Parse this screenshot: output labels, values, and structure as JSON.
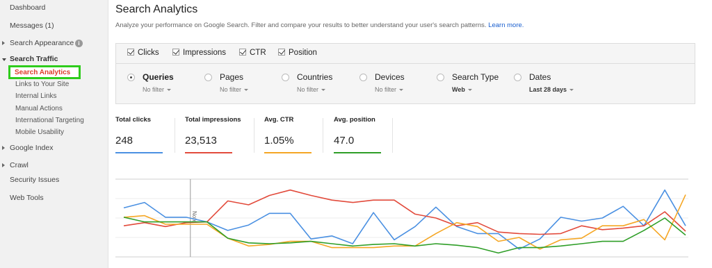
{
  "sidebar": {
    "dashboard": "Dashboard",
    "messages": "Messages (1)",
    "search_appearance": "Search Appearance",
    "info_icon": "i",
    "search_traffic": "Search Traffic",
    "search_analytics": "Search Analytics",
    "links_to_site": "Links to Your Site",
    "internal_links": "Internal Links",
    "manual_actions": "Manual Actions",
    "international_targeting": "International Targeting",
    "mobile_usability": "Mobile Usability",
    "google_index": "Google Index",
    "crawl": "Crawl",
    "security_issues": "Security Issues",
    "web_tools": "Web Tools"
  },
  "header": {
    "title": "Search Analytics",
    "description": "Analyze your performance on Google Search. Filter and compare your results to better understand your user's search patterns.",
    "learn_more": "Learn more."
  },
  "toggles": {
    "clicks": "Clicks",
    "impressions": "Impressions",
    "ctr": "CTR",
    "position": "Position"
  },
  "dimensions": {
    "queries": {
      "label": "Queries",
      "value": "No filter"
    },
    "pages": {
      "label": "Pages",
      "value": "No filter"
    },
    "countries": {
      "label": "Countries",
      "value": "No filter"
    },
    "devices": {
      "label": "Devices",
      "value": "No filter"
    },
    "search_type": {
      "label": "Search Type",
      "value": "Web"
    },
    "dates": {
      "label": "Dates",
      "value": "Last 28 days"
    }
  },
  "selected_dimension": "Queries",
  "metrics": {
    "clicks": {
      "label": "Total clicks",
      "value": "248",
      "color": "#4a90e2"
    },
    "impressions": {
      "label": "Total impressions",
      "value": "23,513",
      "color": "#e24a3b"
    },
    "ctr": {
      "label": "Avg. CTR",
      "value": "1.05%",
      "color": "#f5a623"
    },
    "position": {
      "label": "Avg. position",
      "value": "47.0",
      "color": "#2e9e27"
    }
  },
  "colors": {
    "active_highlight": "#2ecc1b",
    "active_text": "#dd3b2a",
    "link": "#1a5fcf"
  },
  "chart_data": {
    "type": "line",
    "annotation": "Note",
    "x": [
      1,
      2,
      3,
      4,
      5,
      6,
      7,
      8,
      9,
      10,
      11,
      12,
      13,
      14,
      15,
      16,
      17,
      18,
      19,
      20,
      21,
      22,
      23,
      24,
      25,
      26,
      27,
      28
    ],
    "series": [
      {
        "key": "clicks",
        "color": "#4a90e2",
        "values": [
          0.63,
          0.7,
          0.51,
          0.51,
          0.45,
          0.34,
          0.41,
          0.56,
          0.56,
          0.23,
          0.27,
          0.17,
          0.57,
          0.22,
          0.39,
          0.64,
          0.39,
          0.3,
          0.3,
          0.1,
          0.23,
          0.51,
          0.46,
          0.5,
          0.65,
          0.4,
          0.86,
          0.4
        ]
      },
      {
        "key": "impressions",
        "color": "#e24a3b",
        "values": [
          0.4,
          0.44,
          0.39,
          0.44,
          0.45,
          0.72,
          0.67,
          0.79,
          0.86,
          0.79,
          0.73,
          0.7,
          0.73,
          0.73,
          0.55,
          0.5,
          0.4,
          0.44,
          0.32,
          0.3,
          0.29,
          0.3,
          0.4,
          0.35,
          0.37,
          0.4,
          0.58,
          0.33
        ]
      },
      {
        "key": "ctr",
        "color": "#f5a623",
        "values": [
          0.51,
          0.53,
          0.42,
          0.42,
          0.42,
          0.24,
          0.14,
          0.16,
          0.2,
          0.2,
          0.12,
          0.12,
          0.12,
          0.14,
          0.14,
          0.3,
          0.44,
          0.39,
          0.2,
          0.25,
          0.1,
          0.22,
          0.24,
          0.4,
          0.4,
          0.48,
          0.22,
          0.8
        ]
      },
      {
        "key": "position",
        "color": "#2e9e27",
        "values": [
          0.51,
          0.45,
          0.45,
          0.45,
          0.45,
          0.24,
          0.18,
          0.17,
          0.18,
          0.2,
          0.17,
          0.14,
          0.16,
          0.17,
          0.14,
          0.17,
          0.15,
          0.12,
          0.05,
          0.12,
          0.12,
          0.14,
          0.17,
          0.2,
          0.2,
          0.34,
          0.5,
          0.28
        ]
      }
    ]
  }
}
